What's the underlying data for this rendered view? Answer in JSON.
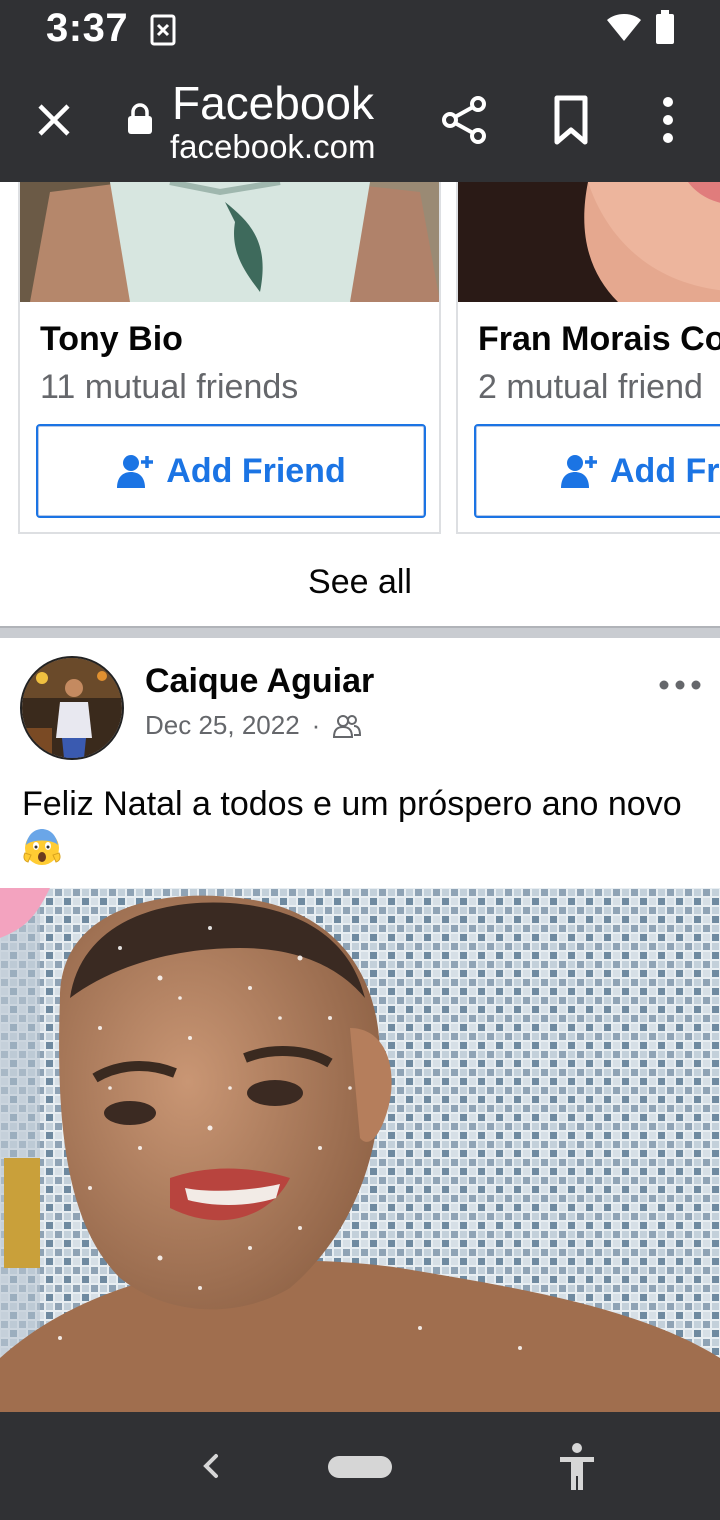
{
  "status_bar": {
    "time": "3:37",
    "icons": [
      "notification-icon",
      "wifi-icon",
      "battery-icon"
    ]
  },
  "toolbar": {
    "title": "Facebook",
    "url": "facebook.com",
    "icons": [
      "close-icon",
      "lock-icon",
      "share-icon",
      "bookmark-icon",
      "more-vert-icon"
    ]
  },
  "suggestions": {
    "cards": [
      {
        "name": "Tony Bio",
        "mutual": "11 mutual friends",
        "button": "Add Friend"
      },
      {
        "name": "Fran Morais Co",
        "mutual": "2 mutual friend",
        "button": "Add Fri"
      }
    ],
    "see_all": "See all"
  },
  "post": {
    "author": "Caique Aguiar",
    "date": "Dec 25, 2022",
    "separator": "·",
    "audience_icon": "friends-icon",
    "text": "Feliz Natal a todos e um próspero ano novo",
    "emoji": "😱"
  },
  "nav_bar": {
    "icons": [
      "back-icon",
      "home-pill",
      "accessibility-icon"
    ]
  },
  "colors": {
    "chrome": "#303134",
    "facebook_blue": "#1b74e4",
    "secondary_text": "#65676b"
  }
}
